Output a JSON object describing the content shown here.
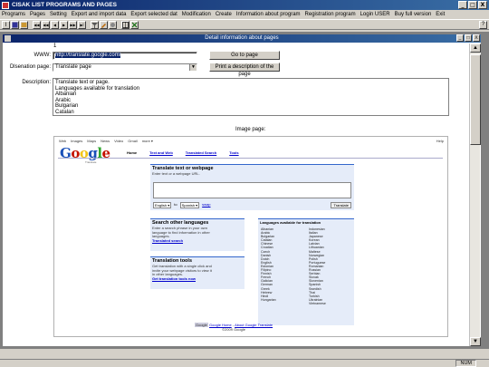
{
  "window": {
    "title": "CISAK LIST PROGRAMS AND PAGES",
    "min": "_",
    "max": "□",
    "close": "X"
  },
  "menu": [
    "Programs",
    "Pages",
    "Setting",
    "Export and import data",
    "Export selected dat",
    "Modification",
    "Create",
    "Information about program",
    "Registration program",
    "Login USER",
    "Buy full version",
    "Exit"
  ],
  "toolbar": {
    "first": "I",
    "prev2": "◀◀",
    "prev": "◀",
    "next": "▶",
    "next2": "▶▶",
    "last": "▶I",
    "help": "?"
  },
  "child": {
    "title": "Detail information about pages",
    "min": "_",
    "max": "□",
    "close": "X"
  },
  "form": {
    "record_no": "1",
    "www_label": "WWW:",
    "www_value": "http://translate.google.com/",
    "goto_label": "Go to page",
    "designation_label": "Dlsenation page:",
    "designation_value": "Translate page",
    "print_label": "Print a description of the page",
    "description_label": "Description:",
    "description_lines": [
      "Translate text or page.",
      "Languages available for translation",
      "Albanian",
      "Arabic",
      "Bulgarian",
      "Catalan"
    ],
    "image_label": "Image page:"
  },
  "google": {
    "nav": [
      "Web",
      "Images",
      "Maps",
      "News",
      "Video",
      "Gmail",
      "more ▾"
    ],
    "help": "Help",
    "logo": "Google",
    "logo_sub": "Translate",
    "tabs": [
      "Home",
      "Text and Web",
      "Translated Search",
      "Tools"
    ],
    "translate_title": "Translate text or webpage",
    "translate_hint": "Enter text or a webpage URL.",
    "from": "English ▾",
    "to_word": "to",
    "to": "Spanish ▾",
    "swap": "swap",
    "translate_btn": "Translate",
    "search_title": "Search other languages",
    "search_text": [
      "Enter a search phrase in your own",
      "language to find information in other",
      "languages."
    ],
    "search_link": "Translated search",
    "tools_title": "Translation tools",
    "tools_text": [
      "Get translation with a single click and",
      "invite your webpage visitors to view it",
      "in other languages."
    ],
    "tools_link": "Get translation tools now",
    "langs_title": "Languages available for translation",
    "langs_col1": [
      "Albanian",
      "Arabic",
      "Bulgarian",
      "Catalan",
      "Chinese",
      "Croatian",
      "Czech",
      "Danish",
      "Dutch",
      "English",
      "Estonian",
      "Filipino",
      "Finnish",
      "French",
      "Galician",
      "German",
      "Greek",
      "Hebrew",
      "Hindi",
      "Hungarian"
    ],
    "langs_col2": [
      "Indonesian",
      "Italian",
      "Japanese",
      "Korean",
      "Latvian",
      "Lithuanian",
      "Maltese",
      "Norwegian",
      "Polish",
      "Portuguese",
      "Romanian",
      "Russian",
      "Serbian",
      "Slovak",
      "Slovenian",
      "Spanish",
      "Swedish",
      "Thai",
      "Turkish",
      "Ukrainian"
    ],
    "langs_col3": "Vietnamese",
    "footer_links": [
      "Google Home",
      "About Google Translate"
    ],
    "footer_copy": "©2009 Google",
    "footer_badge": "Google"
  },
  "status": {
    "num": "NUM"
  }
}
